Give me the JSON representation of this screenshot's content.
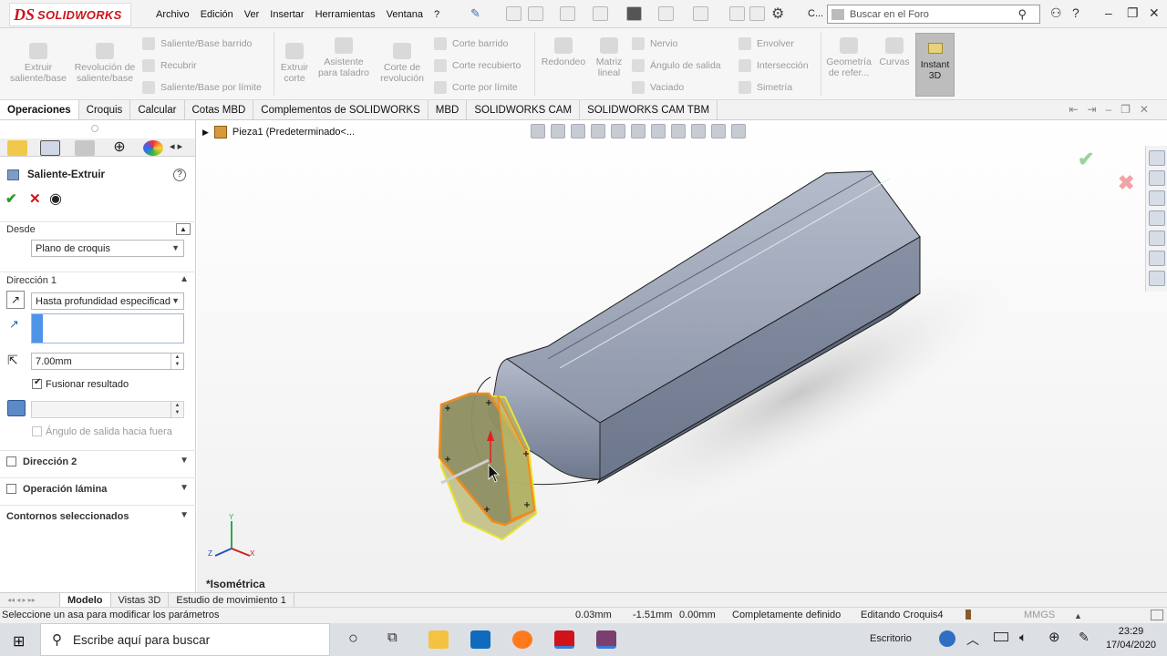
{
  "app": {
    "brand_mark": "DS",
    "brand": "SOLIDWORKS"
  },
  "menu": [
    "Archivo",
    "Edición",
    "Ver",
    "Insertar",
    "Herramientas",
    "Ventana",
    "?"
  ],
  "titlebar": {
    "truncated_title": "C...",
    "search_placeholder": "Buscar en el Foro"
  },
  "commands": {
    "extrude_boss": "Extruir saliente/base",
    "revolve_boss": "Revolución de saliente/base",
    "swept_boss": "Saliente/Base barrido",
    "loft_boss": "Recubrir",
    "boundary_boss": "Saliente/Base por límite",
    "extrude_cut": "Extruir corte",
    "hole_wizard": "Asistente para taladro",
    "revolve_cut": "Corte de revolución",
    "swept_cut": "Corte barrido",
    "loft_cut": "Corte recubierto",
    "boundary_cut": "Corte por límite",
    "fillet": "Redondeo",
    "linear_pattern": "Matriz lineal",
    "rib": "Nervio",
    "draft": "Ángulo de salida",
    "shell": "Vaciado",
    "wrap": "Envolver",
    "intersect": "Intersección",
    "mirror": "Simetría",
    "ref_geometry": "Geometría de refer...",
    "curves": "Curvas",
    "instant3d": "Instant 3D"
  },
  "tabs": [
    "Operaciones",
    "Croquis",
    "Calcular",
    "Cotas MBD",
    "Complementos de SOLIDWORKS",
    "MBD",
    "SOLIDWORKS CAM",
    "SOLIDWORKS CAM TBM"
  ],
  "tree": {
    "label": "Pieza1  (Predeterminado<..."
  },
  "property_manager": {
    "title": "Saliente-Extruir",
    "from_label": "Desde",
    "from_value": "Plano de croquis",
    "dir1_label": "Dirección 1",
    "end_condition": "Hasta profundidad especificad",
    "depth": "7.00mm",
    "merge_label": "Fusionar resultado",
    "draft_outward": "Ángulo de salida hacia fuera",
    "dir2_label": "Dirección 2",
    "thin_label": "Operación lámina",
    "contours_label": "Contornos seleccionados"
  },
  "viewport": {
    "view_name": "*Isométrica",
    "triad": {
      "x": "X",
      "y": "Y",
      "z": "Z"
    }
  },
  "bottom_tabs": [
    "Modelo",
    "Vistas 3D",
    "Estudio de movimiento 1"
  ],
  "status": {
    "message": "Seleccione un asa para modificar los parámetros",
    "x": "0.03mm",
    "y": "-1.51mm",
    "z": "0.00mm",
    "defined": "Completamente definido",
    "editing": "Editando Croquis4",
    "units": "MMGS"
  },
  "taskbar": {
    "search": "Escribe aquí para buscar",
    "desktop": "Escritorio",
    "time": "23:29",
    "date": "17/04/2020"
  },
  "colors": {
    "accent_red": "#d0121b",
    "body": "#8a93a6",
    "sketch_orange": "#f08a1e",
    "preview_yellow": "#e8e430"
  }
}
